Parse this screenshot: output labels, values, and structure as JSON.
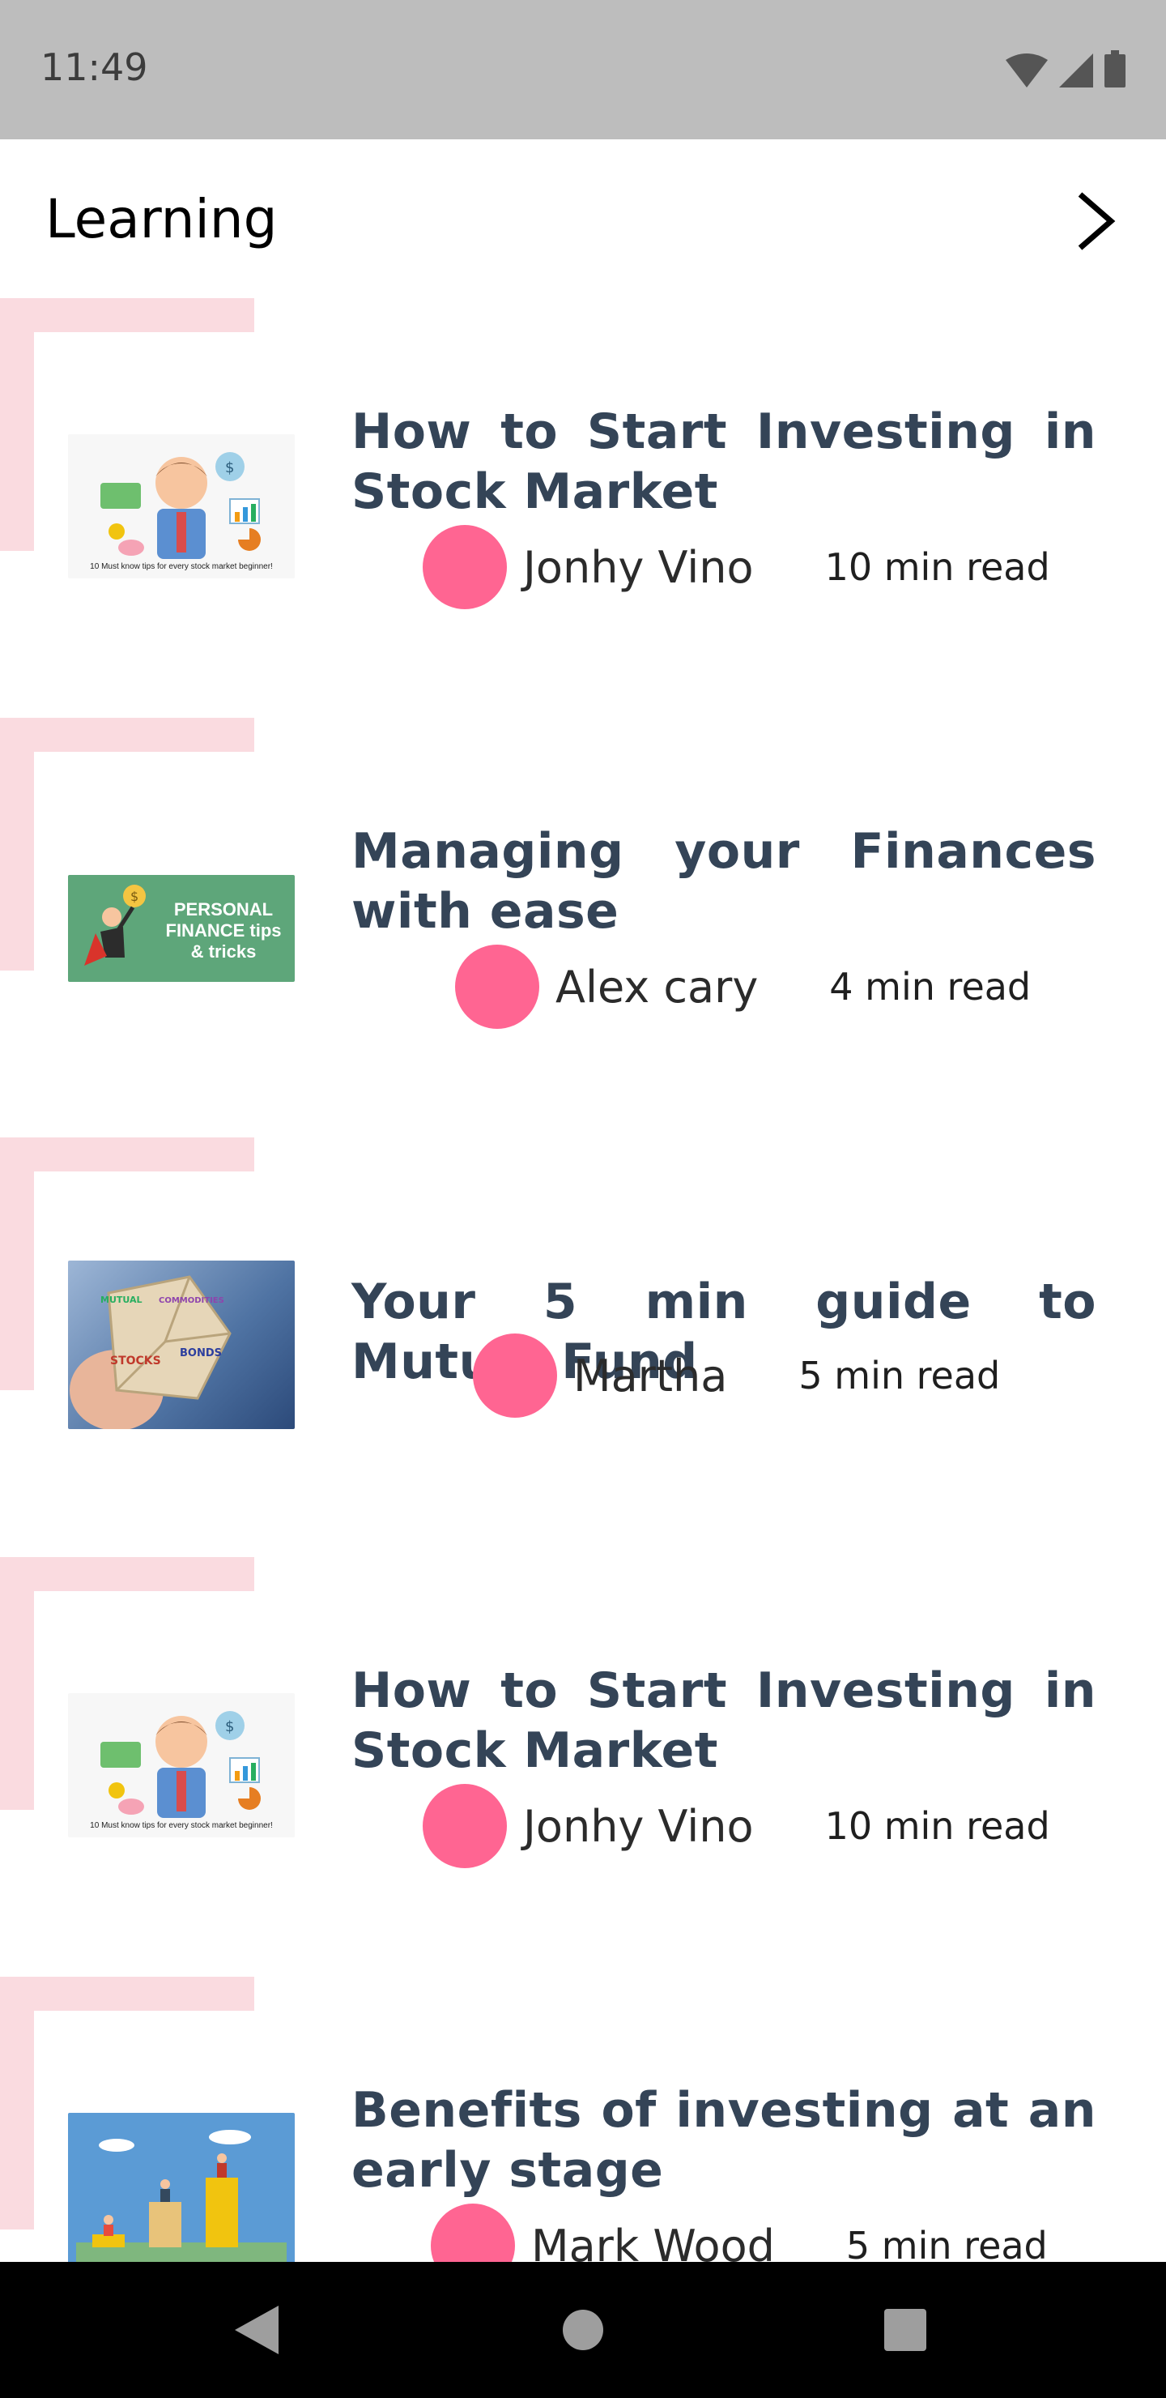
{
  "status": {
    "time": "11:49"
  },
  "header": {
    "title": "Learning"
  },
  "articles": [
    {
      "title": "How to Start Investing in Stock Market",
      "author": "Jonhy Vino",
      "read_time": "10 min read",
      "thumb_caption": "10 Must know tips for every stock market beginner!"
    },
    {
      "title": "Managing your Finances with ease",
      "author": "Alex cary",
      "read_time": "4 min read",
      "thumb_caption": "PERSONAL FINANCE tips & tricks"
    },
    {
      "title": "Your 5 min guide to Mutual Fund",
      "author": "Martha",
      "read_time": "5 min read",
      "thumb_caption": "STOCKS BONDS MUTUAL FUNDS COMMODITIES"
    },
    {
      "title": "How to Start Investing in Stock Market",
      "author": "Jonhy Vino",
      "read_time": "10 min read",
      "thumb_caption": "10 Must know tips for every stock market beginner!"
    },
    {
      "title": "Benefits of investing at an early stage",
      "author": "Mark Wood",
      "read_time": "5 min read",
      "thumb_caption": ""
    }
  ],
  "colors": {
    "accent": "#ff6592",
    "deco": "#fadbe0",
    "title": "#344457"
  }
}
